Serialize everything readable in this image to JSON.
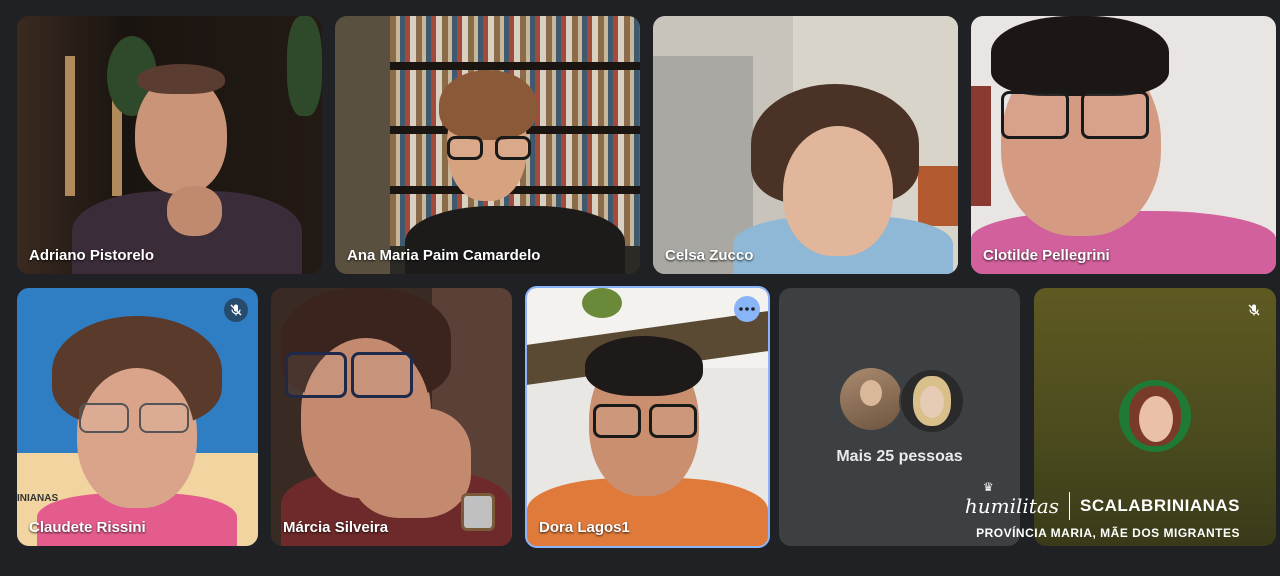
{
  "participants": [
    {
      "name": "Adriano Pistorelo"
    },
    {
      "name": "Ana Maria Paim Camardelo"
    },
    {
      "name": "Celsa Zucco"
    },
    {
      "name": "Clotilde Pellegrini"
    },
    {
      "name": "Claudete Rissini",
      "muted": true
    },
    {
      "name": "Márcia Silveira"
    },
    {
      "name": "Dora Lagos1",
      "active": true
    },
    {
      "name": "Mais 25 pessoas"
    },
    {
      "name": "",
      "muted": true
    }
  ],
  "overflow_label": "Mais 25 pessoas",
  "branding": {
    "humilitas": "humilitas",
    "org": "SCALABRINIANAS",
    "subtitle": "PROVÍNCIA MARIA, MÃE DOS MIGRANTES"
  },
  "background_banner_text": "INIANAS",
  "colors": {
    "background": "#202124",
    "active_border": "#8ab4f8",
    "tile": "#3c4043"
  }
}
